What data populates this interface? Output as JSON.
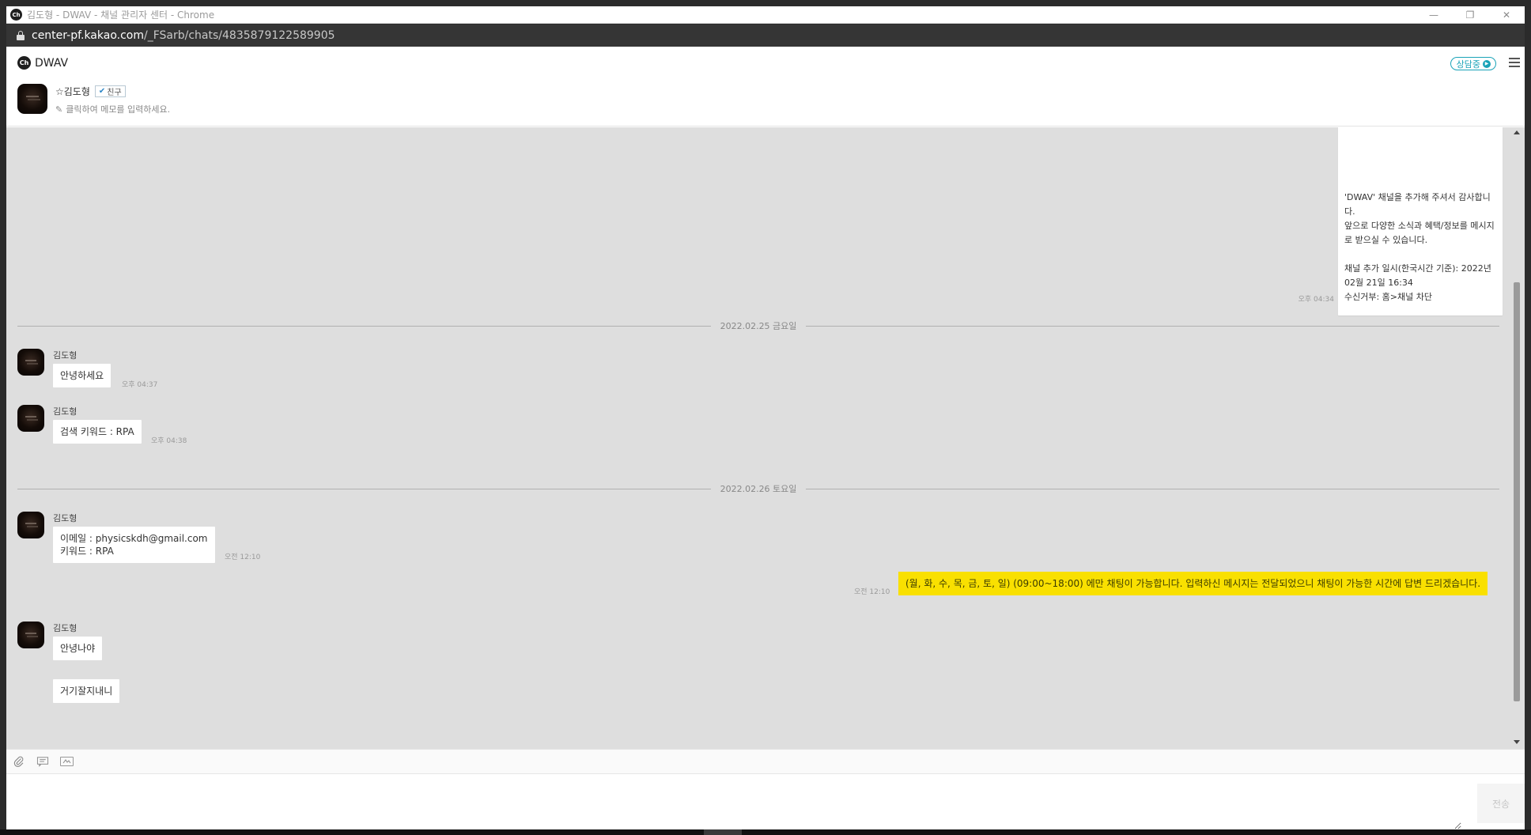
{
  "window": {
    "app_logo": "Ch",
    "title": "김도형 - DWAV - 채널 관리자 센터 - Chrome",
    "controls": {
      "minimize": "—",
      "restore": "❐",
      "close": "✕"
    }
  },
  "address_bar": {
    "url_host": "center-pf.kakao.com",
    "url_path": "/_FSarb/chats/4835879122589905"
  },
  "header": {
    "brand_logo": "Ch",
    "brand_name": "DWAV",
    "status_label": "상담중",
    "menu_icon": "hamburger-icon"
  },
  "profile": {
    "name": "☆김도형",
    "friend_badge": "친구",
    "memo_placeholder": "클릭하여 메모를 입력하세요."
  },
  "chat": {
    "welcome_message": {
      "text": "'DWAV' 채널을 추가해 주셔서 감사합니다.\n앞으로 다양한 소식과 혜택/정보를 메시지로 받으실 수 있습니다.\n\n채널 추가 일시(한국시간 기준): 2022년 02월 21일 16:34\n수신거부: 홈>채널 차단",
      "time": "오후 04:34"
    },
    "date_1": "2022.02.25 금요일",
    "msg_1": {
      "sender": "김도형",
      "text": "안녕하세요",
      "time": "오후 04:37"
    },
    "msg_2": {
      "sender": "김도형",
      "text": "검색 키워드 : RPA",
      "time": "오후 04:38"
    },
    "date_2": "2022.02.26 토요일",
    "msg_3": {
      "sender": "김도형",
      "text": "이메일 : physicskdh@gmail.com\n키워드 : RPA",
      "time": "오전 12:10"
    },
    "auto_reply": {
      "text": "(월, 화, 수, 목, 금, 토, 일) (09:00~18:00) 에만 채팅이 가능합니다. 입력하신 메시지는 전달되었으니 채팅이 가능한 시간에 답변 드리겠습니다.",
      "time": "오전 12:10"
    },
    "msg_4": {
      "sender": "김도형",
      "text": "안녕나야"
    },
    "msg_5": {
      "text": "거기잘지내니"
    }
  },
  "composer": {
    "attach_icon": "paperclip-icon",
    "template_icon": "message-template-icon",
    "emoticon_icon": "image-box-icon",
    "send_label": "전송"
  }
}
